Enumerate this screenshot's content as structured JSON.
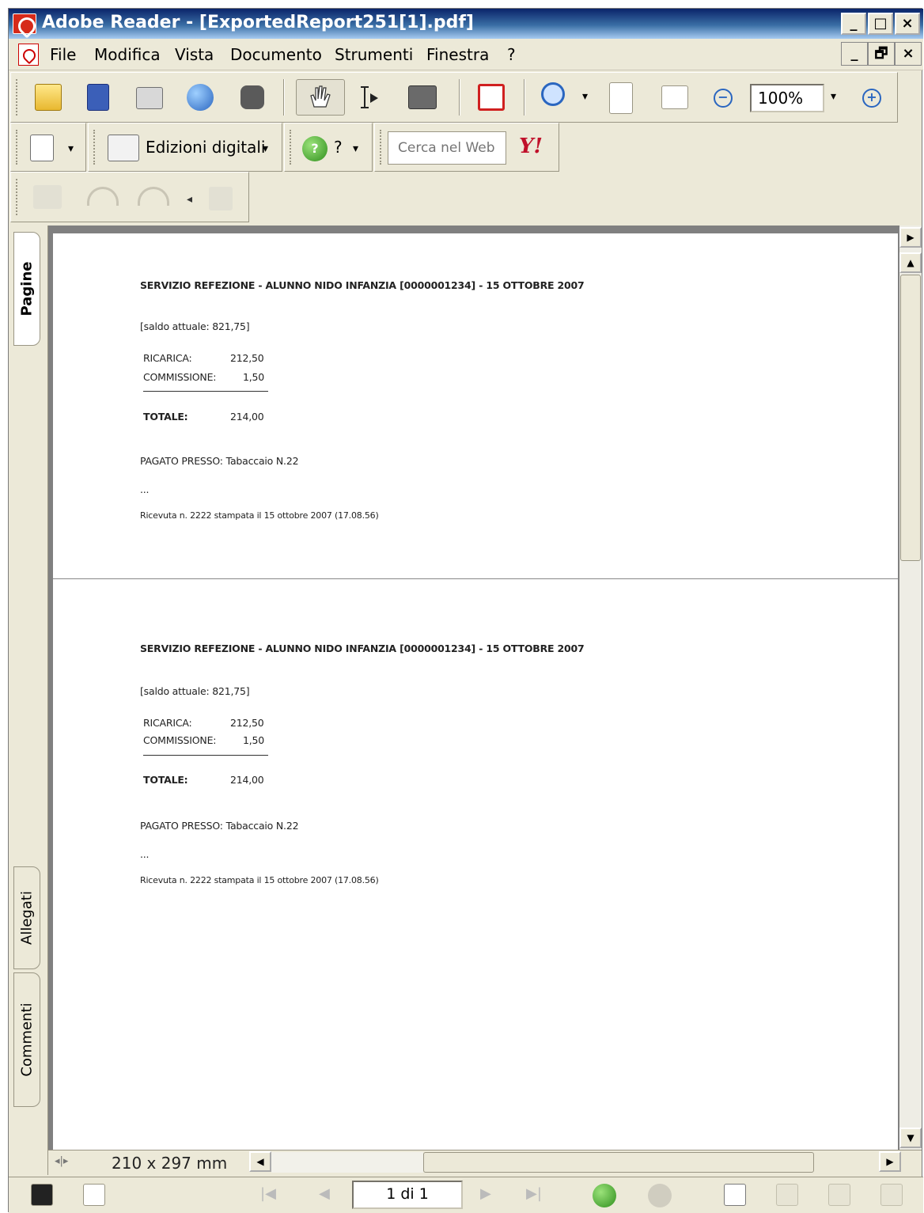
{
  "window": {
    "title": "Adobe Reader - [ExportedReport251[1].pdf]",
    "min_label": "_",
    "max_label": "□",
    "close_label": "×",
    "mdi_min": "_",
    "mdi_restore": "🗗",
    "mdi_close": "×"
  },
  "menu": {
    "items": [
      "File",
      "Modifica",
      "Vista",
      "Documento",
      "Strumenti",
      "Finestra",
      "?"
    ]
  },
  "toolbar": {
    "zoom_value": "100%",
    "edizioni_label": "Edizioni digitali",
    "help_label": "?",
    "search_placeholder": "Cerca nel Web",
    "yahoo_label": "Y!"
  },
  "navpanel": {
    "tabs": [
      "Pagine",
      "Allegati",
      "Commenti"
    ]
  },
  "receipts": [
    {
      "heading": "SERVIZIO REFEZIONE - ALUNNO NIDO INFANZIA [0000001234] - 15 OTTOBRE 2007",
      "saldo": "[saldo attuale: 821,75]",
      "ricarica_label": "RICARICA:",
      "ricarica_value": "212,50",
      "commissione_label": "COMMISSIONE:",
      "commissione_value": "1,50",
      "totale_label": "TOTALE:",
      "totale_value": "214,00",
      "pagato": "PAGATO PRESSO: Tabaccaio N.22",
      "dots": "...",
      "ricevuta": "Ricevuta n. 2222 stampata il 15 ottobre 2007 (17.08.56)"
    },
    {
      "heading": "SERVIZIO REFEZIONE - ALUNNO NIDO INFANZIA [0000001234] - 15 OTTOBRE 2007",
      "saldo": "[saldo attuale: 821,75]",
      "ricarica_label": "RICARICA:",
      "ricarica_value": "212,50",
      "commissione_label": "COMMISSIONE:",
      "commissione_value": "1,50",
      "totale_label": "TOTALE:",
      "totale_value": "214,00",
      "pagato": "PAGATO PRESSO: Tabaccaio N.22",
      "dots": "...",
      "ricevuta": "Ricevuta n. 2222 stampata il 15 ottobre 2007 (17.08.56)"
    }
  ],
  "hbar": {
    "page_size": "210 x 297 mm"
  },
  "status": {
    "page_field": "1 di 1"
  },
  "colors": {
    "accent": "#0a246a",
    "chrome": "#ece9d8",
    "brand_red": "#d62a1a"
  }
}
